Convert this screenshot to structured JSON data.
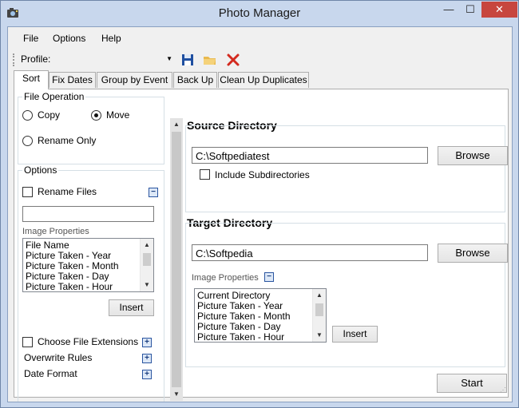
{
  "window": {
    "title": "Photo Manager",
    "minimize_glyph": "—",
    "maximize_glyph": "☐",
    "close_glyph": "✕"
  },
  "menu": [
    "File",
    "Options",
    "Help"
  ],
  "toolbar": {
    "profile_label": "Profile:",
    "profile_value": "",
    "icons": [
      "save-icon",
      "open-folder-icon",
      "delete-icon"
    ]
  },
  "tabs": [
    {
      "label": "Sort",
      "active": true
    },
    {
      "label": "Fix Dates",
      "active": false
    },
    {
      "label": "Group by Event",
      "active": false
    },
    {
      "label": "Back Up",
      "active": false
    },
    {
      "label": "Clean Up Duplicates",
      "active": false
    }
  ],
  "file_operation": {
    "title": "File Operation",
    "copy": "Copy",
    "move": "Move",
    "rename_only": "Rename Only",
    "selected": "Move"
  },
  "options": {
    "title": "Options",
    "rename_files": "Rename Files",
    "rename_files_checked": false,
    "rename_pattern": "",
    "image_properties_label": "Image Properties",
    "properties": [
      "File Name",
      "Picture Taken - Year",
      "Picture Taken - Month",
      "Picture Taken - Day",
      "Picture Taken - Hour"
    ],
    "insert": "Insert",
    "choose_file_extensions": "Choose File Extensions",
    "overwrite_rules": "Overwrite Rules",
    "date_format": "Date Format"
  },
  "source": {
    "title": "Source Directory",
    "path": "C:\\Softpediatest",
    "browse": "Browse",
    "include_subdirectories": "Include Subdirectories",
    "include_subdirectories_checked": false
  },
  "target": {
    "title": "Target Directory",
    "path": "C:\\Softpedia",
    "browse": "Browse",
    "image_properties_label": "Image Properties",
    "properties": [
      "Current Directory",
      "Picture Taken - Year",
      "Picture Taken - Month",
      "Picture Taken - Day",
      "Picture Taken - Hour"
    ],
    "insert": "Insert"
  },
  "start": "Start",
  "colors": {
    "frame": "#c8d7ed",
    "close_button": "#c7463e",
    "accent_blue": "#2a55a0"
  }
}
